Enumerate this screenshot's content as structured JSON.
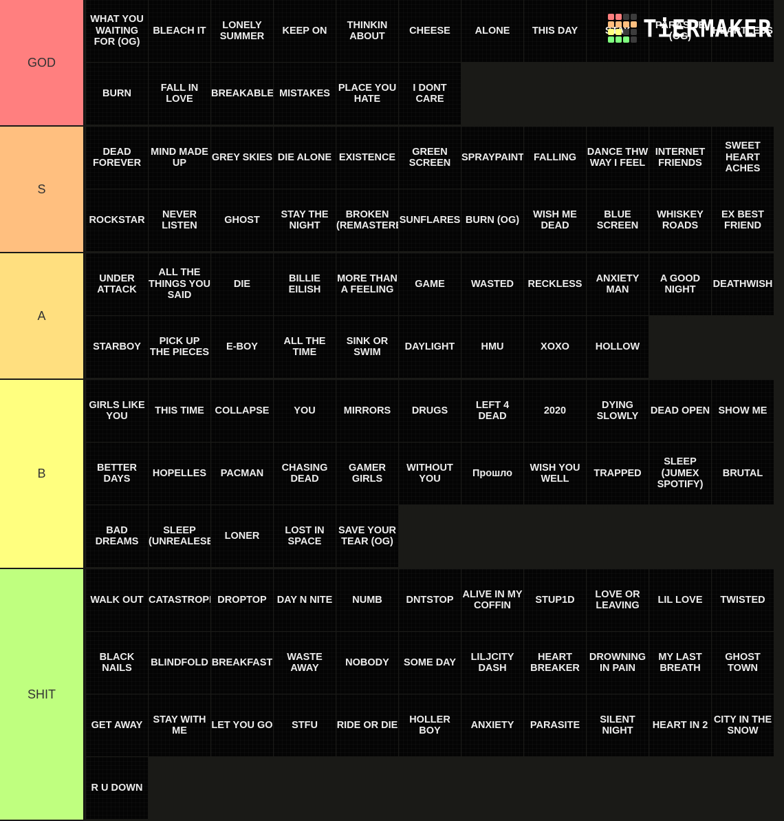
{
  "logo": {
    "text": "TiERMAKER",
    "grid_colors": [
      "#ff7f7f",
      "#ff7f7f",
      "#3c3c3c",
      "#3c3c3c",
      "#ffbf7f",
      "#ffbf7f",
      "#ffbf7f",
      "#ffbf7f",
      "#ffff7f",
      "#ffff7f",
      "#3c3c3c",
      "#3c3c3c",
      "#7fff7f",
      "#7fff7f",
      "#7fff7f",
      "#3c3c3c"
    ]
  },
  "tiers": [
    {
      "label": "GOD",
      "color": "#ff7f7f",
      "items": [
        "WHAT YOU WAITING FOR (OG)",
        "BLEACH IT",
        "LONELY SUMMER",
        "KEEP ON",
        "THINKIN ABOUT",
        "CHEESE",
        "ALONE",
        "THIS DAY",
        "STAY",
        "PARASITE (OG)",
        "HEARTLESS",
        "BURN",
        "FALL IN LOVE",
        "BREAKABLE",
        "MISTAKES",
        "PLACE YOU HATE",
        "I DONT CARE"
      ]
    },
    {
      "label": "S",
      "color": "#ffbf7f",
      "items": [
        "DEAD FOREVER",
        "MIND MADE UP",
        "GREY SKIES",
        "DIE ALONE",
        "EXISTENCE",
        "GREEN SCREEN",
        "SPRAYPAINT",
        "FALLING",
        "DANCE THW WAY I FEEL",
        "INTERNET FRIENDS",
        "SWEET HEART ACHES",
        "ROCKSTAR",
        "NEVER LISTEN",
        "GHOST",
        "STAY THE NIGHT",
        "BROKEN (REMASTERED)",
        "SUNFLARES",
        "BURN (OG)",
        "WISH ME DEAD",
        "BLUE SCREEN",
        "WHISKEY ROADS",
        "EX BEST FRIEND"
      ]
    },
    {
      "label": "A",
      "color": "#ffdf7f",
      "items": [
        "UNDER ATTACK",
        "ALL THE THINGS YOU SAID",
        "DIE",
        "BILLIE EILISH",
        "MORE THAN A FEELING",
        "GAME",
        "WASTED",
        "RECKLESS",
        "ANXIETY MAN",
        "A GOOD NIGHT",
        "DEATHWISH",
        "STARBOY",
        "PICK UP THE PIECES",
        "E-BOY",
        "ALL THE TIME",
        "SINK OR SWIM",
        "DAYLIGHT",
        "HMU",
        "XOXO",
        "HOLLOW"
      ]
    },
    {
      "label": "B",
      "color": "#ffff7f",
      "items": [
        "GIRLS LIKE YOU",
        "THIS TIME",
        "COLLAPSE",
        "YOU",
        "MIRRORS",
        "DRUGS",
        "LEFT 4 DEAD",
        "2020",
        "DYING SLOWLY",
        "DEAD OPEN",
        "SHOW ME",
        "BETTER DAYS",
        "HOPELLES",
        "PACMAN",
        "CHASING DEAD",
        "GAMER GIRLS",
        "WITHOUT YOU",
        "Прошло",
        "WISH YOU WELL",
        "TRAPPED",
        "SLEEP (JUMEX SPOTIFY)",
        "BRUTAL",
        "BAD DREAMS",
        "SLEEP (UNREALESED)",
        "LONER",
        "LOST IN SPACE",
        "SAVE YOUR TEAR (OG)"
      ]
    },
    {
      "label": "SHIT",
      "color": "#bfff7f",
      "items": [
        "WALK OUT",
        "CATASTROPHE",
        "DROPTOP",
        "DAY N NITE",
        "NUMB",
        "DNTSTOP",
        "ALIVE IN MY COFFIN",
        "STUP1D",
        "LOVE OR LEAVING",
        "LIL LOVE",
        "TWISTED",
        "BLACK NAILS",
        "BLINDFOLD",
        "BREAKFAST",
        "WASTE AWAY",
        "NOBODY",
        "SOME DAY",
        "LILJCITY DASH",
        "HEART BREAKER",
        "DROWNING IN PAIN",
        "MY LAST BREATH",
        "GHOST TOWN",
        "GET AWAY",
        "STAY WITH ME",
        "LET YOU GO",
        "STFU",
        "RIDE OR DIE",
        "HOLLER BOY",
        "ANXIETY",
        "PARASITE",
        "SILENT NIGHT",
        "HEART IN 2",
        "CITY IN THE SNOW",
        "R U DOWN"
      ]
    }
  ]
}
